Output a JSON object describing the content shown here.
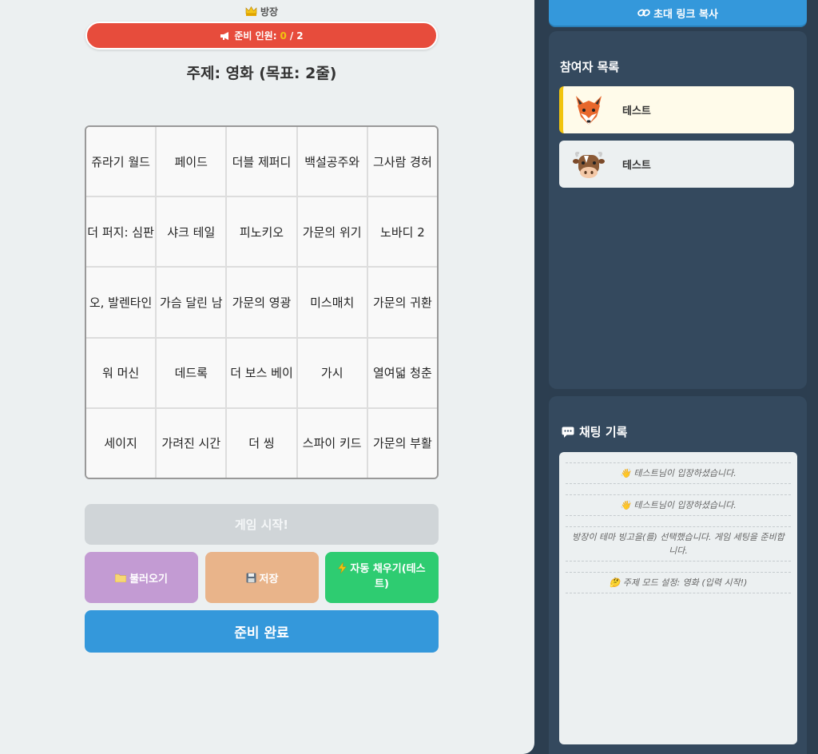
{
  "header": {
    "host_label": "방장",
    "ready_label": "준비 인원:",
    "ready_current": "0",
    "ready_sep": " / ",
    "ready_total": "2",
    "topic": "주제: 영화 (목표: 2줄)"
  },
  "board": [
    "쥬라기 월드",
    "페이드",
    "더블 제퍼디",
    "백설공주와",
    "그사람 경허",
    "더 퍼지: 심판",
    "샤크 테일",
    "피노키오",
    "가문의 위기",
    "노바디 2",
    "오, 발렌타인",
    "가슴 달린 남",
    "가문의 영광",
    "미스매치",
    "가문의 귀환",
    "워 머신",
    "데드록",
    "더 보스 베이",
    "가시",
    "열여덟 청춘",
    "세이지",
    "가려진 시간",
    "더 씽",
    "스파이 키드",
    "가문의 부활"
  ],
  "buttons": {
    "start": "게임 시작!",
    "load": "불러오기",
    "save": "저장",
    "auto_fill": "자동 채우기(테스트)",
    "ready": "준비 완료",
    "invite": "초대 링크 복사"
  },
  "players": {
    "title": "참여자 목록",
    "list": [
      {
        "name": "테스트",
        "avatar": "fox-icon"
      },
      {
        "name": "테스트",
        "avatar": "cow-icon"
      }
    ]
  },
  "chat": {
    "title": "채팅 기록",
    "messages": [
      "👋 테스트님이 입장하셨습니다.",
      "👋 테스트님이 입장하셨습니다.",
      "방장이 테마 빙고을(를) 선택했습니다. 게임 세팅을 준비합니다.",
      "🤔 주제 모드 설정: 영화 (입력 시작!)"
    ]
  },
  "colors": {
    "ready_bar": "#e74c3c",
    "ready_count": "#f1c40f",
    "primary": "#3498db",
    "auto_fill": "#2ecc71",
    "load": "#c39bd3",
    "save": "#e9b48a",
    "panel": "#34495e"
  }
}
